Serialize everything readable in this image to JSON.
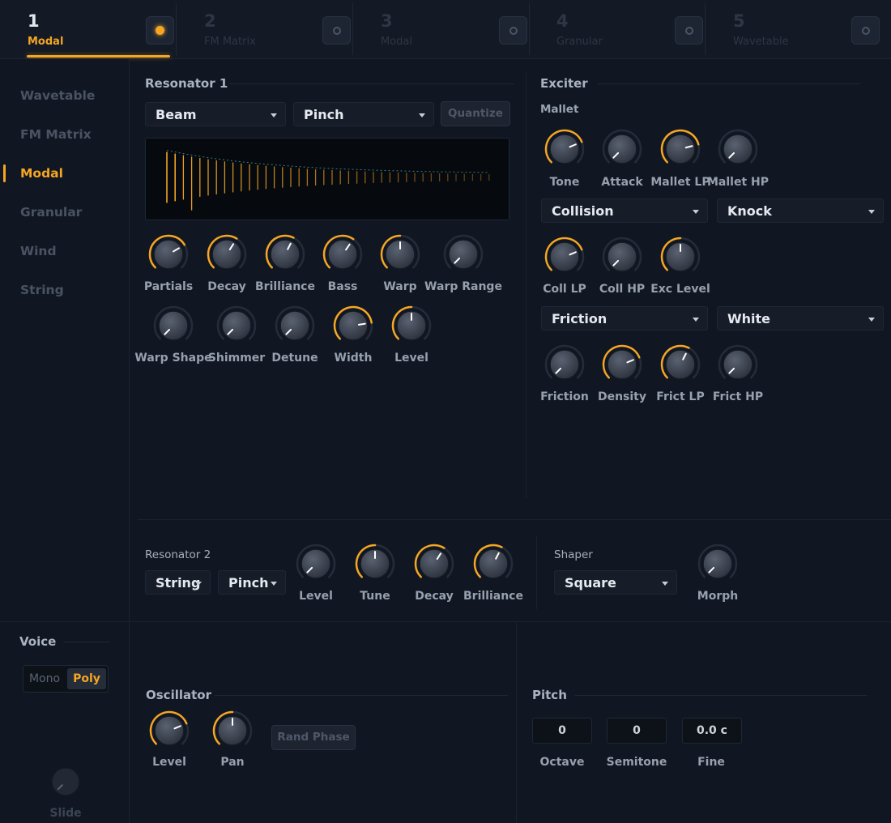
{
  "tabs": [
    {
      "num": "1",
      "name": "Modal",
      "active": true,
      "led_on": true
    },
    {
      "num": "2",
      "name": "FM Matrix",
      "active": false,
      "led_on": false
    },
    {
      "num": "3",
      "name": "Modal",
      "active": false,
      "led_on": false
    },
    {
      "num": "4",
      "name": "Granular",
      "active": false,
      "led_on": false
    },
    {
      "num": "5",
      "name": "Wavetable",
      "active": false,
      "led_on": false
    }
  ],
  "sidebar": {
    "items": [
      {
        "label": "Wavetable",
        "active": false
      },
      {
        "label": "FM Matrix",
        "active": false
      },
      {
        "label": "Modal",
        "active": true
      },
      {
        "label": "Granular",
        "active": false
      },
      {
        "label": "Wind",
        "active": false
      },
      {
        "label": "String",
        "active": false
      }
    ]
  },
  "resonator1": {
    "title": "Resonator 1",
    "type": "Beam",
    "mode": "Pinch",
    "quantize_label": "Quantize",
    "knobs": [
      {
        "label": "Partials",
        "value": 0.72
      },
      {
        "label": "Decay",
        "value": 0.62
      },
      {
        "label": "Brilliance",
        "value": 0.6
      },
      {
        "label": "Bass",
        "value": 0.63
      },
      {
        "label": "Warp",
        "value": 0.5
      },
      {
        "label": "Warp Range",
        "value": 0.0
      },
      {
        "label": "Warp Shape",
        "value": 0.0
      },
      {
        "label": "Shimmer",
        "value": 0.0
      },
      {
        "label": "Detune",
        "value": 0.0
      },
      {
        "label": "Width",
        "value": 0.8
      },
      {
        "label": "Level",
        "value": 0.5
      }
    ]
  },
  "exciter": {
    "title": "Exciter",
    "subtitle": "Mallet",
    "mallet_knobs": [
      {
        "label": "Tone",
        "value": 0.75
      },
      {
        "label": "Attack",
        "value": 0.0
      },
      {
        "label": "Mallet LP",
        "value": 0.78
      },
      {
        "label": "Mallet HP",
        "value": 0.0
      }
    ],
    "collision_type": "Collision",
    "collision_mode": "Knock",
    "collision_knobs": [
      {
        "label": "Coll LP",
        "value": 0.75
      },
      {
        "label": "Coll HP",
        "value": 0.0
      },
      {
        "label": "Exc Level",
        "value": 0.5
      }
    ],
    "friction_type": "Friction",
    "friction_mode": "White",
    "friction_knobs": [
      {
        "label": "Friction",
        "value": 0.0
      },
      {
        "label": "Density",
        "value": 0.75
      },
      {
        "label": "Frict LP",
        "value": 0.6
      },
      {
        "label": "Frict HP",
        "value": 0.0
      }
    ]
  },
  "resonator2": {
    "title": "Resonator 2",
    "type": "String",
    "mode": "Pinch",
    "knobs": [
      {
        "label": "Level",
        "value": 0.0
      },
      {
        "label": "Tune",
        "value": 0.5
      },
      {
        "label": "Decay",
        "value": 0.62
      },
      {
        "label": "Brilliance",
        "value": 0.6
      }
    ]
  },
  "shaper": {
    "title": "Shaper",
    "type": "Square",
    "knobs": [
      {
        "label": "Morph",
        "value": 0.0
      }
    ]
  },
  "voice": {
    "title": "Voice",
    "mono_label": "Mono",
    "poly_label": "Poly",
    "selected": "Poly",
    "slide_label": "Slide",
    "slide_value": 0.0
  },
  "oscillator": {
    "title": "Oscillator",
    "knobs": [
      {
        "label": "Level",
        "value": 0.75
      },
      {
        "label": "Pan",
        "value": 0.5
      }
    ],
    "rand_phase_label": "Rand Phase"
  },
  "pitch": {
    "title": "Pitch",
    "fields": [
      {
        "label": "Octave",
        "value": "0"
      },
      {
        "label": "Semitone",
        "value": "0"
      },
      {
        "label": "Fine",
        "value": "0.0 c"
      }
    ]
  },
  "colors": {
    "accent": "#f5a623",
    "background": "#111722",
    "knob_track": "#252c39"
  }
}
